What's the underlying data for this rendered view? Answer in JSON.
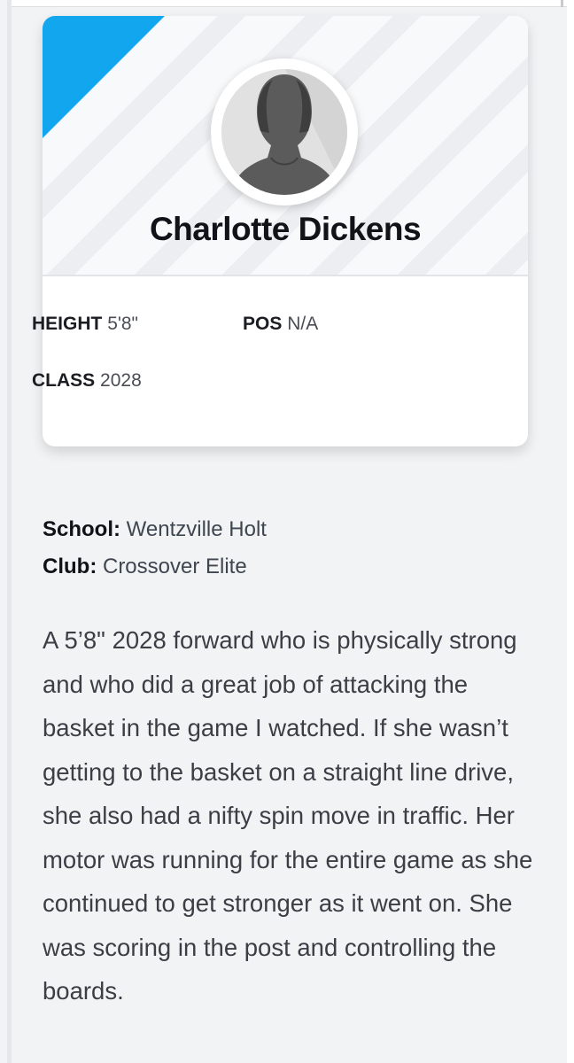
{
  "player": {
    "name": "Charlotte Dickens",
    "height_label": "HEIGHT",
    "height_value": "5'8\"",
    "pos_label": "POS",
    "pos_value": "N/A",
    "class_label": "CLASS",
    "class_value": "2028"
  },
  "details": {
    "school_label": "School:",
    "school_value": "Wentzville Holt",
    "club_label": "Club:",
    "club_value": "Crossover Elite"
  },
  "bio": "A 5’8\" 2028 forward who is physically strong and who did a great job of attacking the basket in the game I watched. If she wasn’t getting to the basket on a straight line drive, she also had a nifty spin move in traffic. Her motor was running for the entire game as she continued to get stronger as it went on. She was scoring in the post and controlling the boards.",
  "colors": {
    "accent": "#11a6ee",
    "background": "#f2f3f5",
    "card": "#ffffff"
  },
  "icons": {
    "avatar": "female-silhouette-avatar"
  }
}
